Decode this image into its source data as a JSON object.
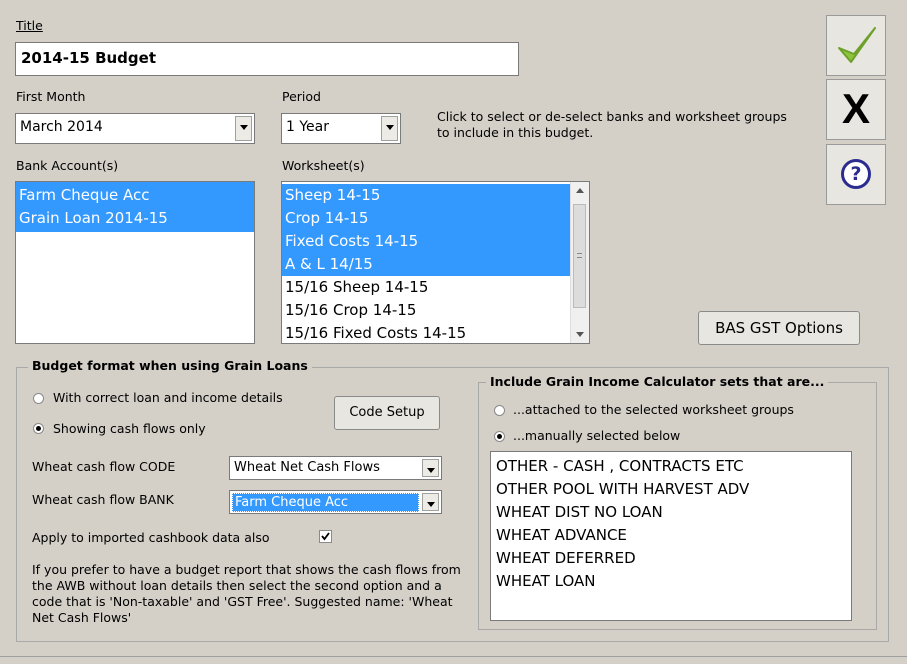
{
  "title": {
    "label": "Title",
    "value": "2014-15 Budget"
  },
  "first_month": {
    "label": "First Month",
    "value": "March 2014"
  },
  "period": {
    "label": "Period",
    "value": "1 Year"
  },
  "instruction": "Click to select or de-select banks and worksheet groups to include in this budget.",
  "bank_accounts": {
    "label": "Bank Account(s)",
    "items": [
      {
        "label": "Farm Cheque Acc"
      },
      {
        "label": "Grain Loan 2014-15"
      }
    ]
  },
  "worksheets": {
    "label": "Worksheet(s)",
    "items": [
      {
        "label": "Sheep 14-15",
        "selected": true
      },
      {
        "label": "Crop 14-15",
        "selected": true
      },
      {
        "label": "Fixed Costs 14-15",
        "selected": true
      },
      {
        "label": "A & L 14/15",
        "selected": true
      },
      {
        "label": "15/16 Sheep 14-15",
        "selected": false
      },
      {
        "label": "15/16 Crop 14-15",
        "selected": false
      },
      {
        "label": "15/16 Fixed Costs 14-15",
        "selected": false
      }
    ]
  },
  "buttons": {
    "ok": "ok",
    "cancel": "X",
    "help": "?",
    "bas_gst": "BAS GST Options",
    "code_setup": "Code Setup"
  },
  "grain_format": {
    "legend": "Budget format when using Grain Loans",
    "radio1": "With correct loan and income details",
    "radio2": "Showing cash flows only",
    "code_label": "Wheat cash flow CODE",
    "code_value": "Wheat Net Cash Flows",
    "bank_label": "Wheat cash flow BANK",
    "bank_value": "Farm Cheque Acc",
    "apply_label": "Apply to imported cashbook data also",
    "help_text": "If you prefer to have a budget report that shows the cash flows from the AWB without loan details then select the second option and a code that is 'Non-taxable' and 'GST Free'. Suggested name: 'Wheat Net Cash Flows'"
  },
  "gic": {
    "legend": "Include Grain Income Calculator sets that are...",
    "radio1": "...attached to the selected worksheet groups",
    "radio2": "...manually selected below",
    "items": [
      {
        "label": "OTHER - CASH , CONTRACTS ETC"
      },
      {
        "label": "OTHER POOL WITH HARVEST ADV"
      },
      {
        "label": "WHEAT  DIST NO LOAN"
      },
      {
        "label": "WHEAT ADVANCE"
      },
      {
        "label": "WHEAT DEFERRED"
      },
      {
        "label": "WHEAT LOAN"
      }
    ]
  },
  "colors": {
    "selection": "#3399ff",
    "check": "#8cc43c",
    "help": "#2a2d8f"
  }
}
